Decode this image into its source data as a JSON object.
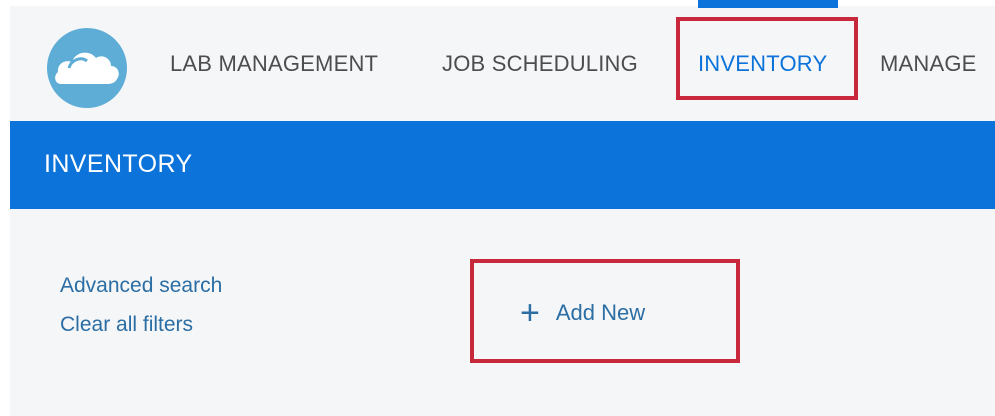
{
  "nav": {
    "items": [
      {
        "label": "LAB MANAGEMENT"
      },
      {
        "label": "JOB SCHEDULING"
      },
      {
        "label": "INVENTORY",
        "active": true
      },
      {
        "label": "MANAGE"
      }
    ]
  },
  "banner": {
    "title": "INVENTORY"
  },
  "filters": {
    "advanced_search": "Advanced search",
    "clear_all": "Clear all filters"
  },
  "actions": {
    "add_new_icon": "+",
    "add_new_label": "Add New"
  },
  "colors": {
    "accent": "#0b73d9",
    "link": "#2b6ea4",
    "highlight": "#c8283b",
    "logo": "#5dadd7"
  }
}
